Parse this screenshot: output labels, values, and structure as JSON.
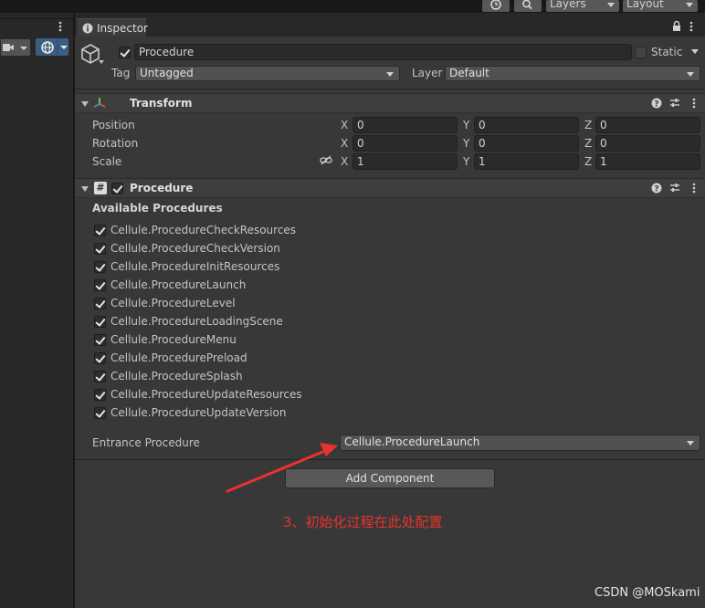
{
  "toolbar": {
    "history_icon": "history-icon",
    "search_icon": "search-icon",
    "layers_label": "Layers",
    "layout_label": "Layout"
  },
  "inspector": {
    "tab_label": "Inspector",
    "object": {
      "active": true,
      "name": "Procedure",
      "static_label": "Static",
      "static_checked": false,
      "tag_label": "Tag",
      "tag_value": "Untagged",
      "layer_label": "Layer",
      "layer_value": "Default"
    },
    "transform": {
      "title": "Transform",
      "rows": [
        {
          "label": "Position",
          "x": "0",
          "y": "0",
          "z": "0"
        },
        {
          "label": "Rotation",
          "x": "0",
          "y": "0",
          "z": "0"
        },
        {
          "label": "Scale",
          "x": "1",
          "y": "1",
          "z": "1"
        }
      ],
      "axis_x": "X",
      "axis_y": "Y",
      "axis_z": "Z"
    },
    "procedure": {
      "title": "Procedure",
      "enabled": true,
      "script_icon_glyph": "#",
      "available_label": "Available Procedures",
      "items": [
        {
          "label": "Cellule.ProcedureCheckResources",
          "checked": true
        },
        {
          "label": "Cellule.ProcedureCheckVersion",
          "checked": true
        },
        {
          "label": "Cellule.ProcedureInitResources",
          "checked": true
        },
        {
          "label": "Cellule.ProcedureLaunch",
          "checked": true
        },
        {
          "label": "Cellule.ProcedureLevel",
          "checked": true
        },
        {
          "label": "Cellule.ProcedureLoadingScene",
          "checked": true
        },
        {
          "label": "Cellule.ProcedureMenu",
          "checked": true
        },
        {
          "label": "Cellule.ProcedurePreload",
          "checked": true
        },
        {
          "label": "Cellule.ProcedureSplash",
          "checked": true
        },
        {
          "label": "Cellule.ProcedureUpdateResources",
          "checked": true
        },
        {
          "label": "Cellule.ProcedureUpdateVersion",
          "checked": true
        }
      ],
      "entrance_label": "Entrance Procedure",
      "entrance_value": "Cellule.ProcedureLaunch"
    },
    "add_component_label": "Add Component"
  },
  "annotation": {
    "text": "3、初始化过程在此处配置",
    "color": "#e8332e"
  },
  "watermark": "CSDN @MOSkami"
}
